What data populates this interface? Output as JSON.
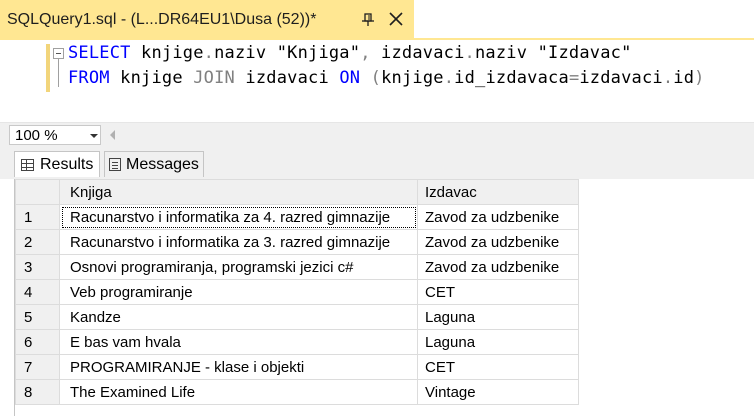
{
  "tab": {
    "title": "SQLQuery1.sql - (L...DR64EU1\\Dusa (52))*"
  },
  "editor": {
    "line1": {
      "kw1": "SELECT",
      "t1": " knjige",
      "d1": ".",
      "t2": "naziv ",
      "s1": "\"Knjiga\"",
      "c1": ",",
      "t3": " izdavaci",
      "d2": ".",
      "t4": "naziv ",
      "s2": "\"Izdavac\""
    },
    "line2": {
      "kw1": "FROM",
      "t1": " knjige ",
      "kw2": "JOIN",
      "t2": " izdavaci ",
      "kw3": "ON",
      "p1": " (",
      "t3": "knjige",
      "d1": ".",
      "t4": "id_izdavaca",
      "eq": "=",
      "t5": "izdavaci",
      "d2": ".",
      "t6": "id",
      "p2": ")"
    }
  },
  "zoom": {
    "value": "100 %"
  },
  "results_tabs": {
    "results": "Results",
    "messages": "Messages"
  },
  "grid": {
    "columns": [
      "Knjiga",
      "Izdavac"
    ],
    "rows": [
      {
        "n": "1",
        "knjiga": "Racunarstvo i informatika za 4. razred gimnazije",
        "izdavac": "Zavod za udzbenike"
      },
      {
        "n": "2",
        "knjiga": "Racunarstvo i informatika za 3. razred gimnazije",
        "izdavac": "Zavod za udzbenike"
      },
      {
        "n": "3",
        "knjiga": "Osnovi programiranja, programski jezici c#",
        "izdavac": "Zavod za udzbenike"
      },
      {
        "n": "4",
        "knjiga": "Veb programiranje",
        "izdavac": "CET"
      },
      {
        "n": "5",
        "knjiga": "Kandze",
        "izdavac": "Laguna"
      },
      {
        "n": "6",
        "knjiga": "E bas vam hvala",
        "izdavac": "Laguna"
      },
      {
        "n": "7",
        "knjiga": "PROGRAMIRANJE - klase i objekti",
        "izdavac": "CET"
      },
      {
        "n": "8",
        "knjiga": "The Examined Life",
        "izdavac": "Vintage"
      }
    ]
  },
  "icons": {
    "pin": "pin-icon",
    "close": "close-icon",
    "results": "grid-icon",
    "messages": "messages-icon"
  }
}
